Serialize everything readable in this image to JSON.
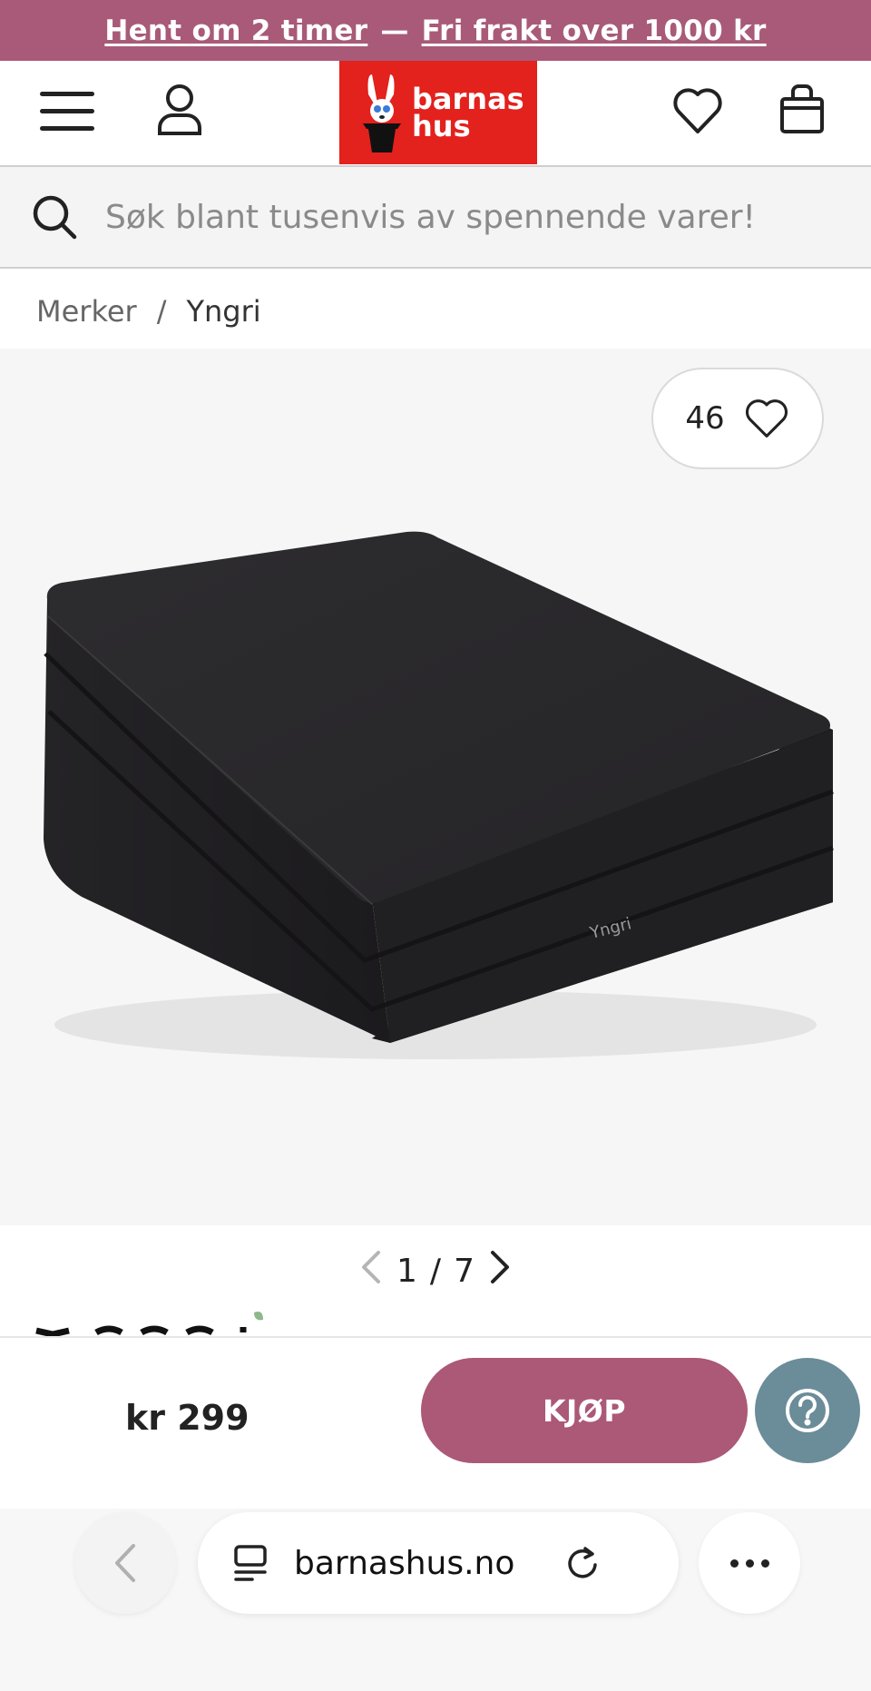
{
  "promo": {
    "pickup_text": "Hent om 2 timer",
    "separator": "—",
    "shipping_text": "Fri frakt over 1000 kr"
  },
  "header": {
    "logo_line1": "barnas",
    "logo_line2": "hus",
    "icons": [
      "menu-icon",
      "user-icon",
      "heart-icon",
      "shopping-bag-icon"
    ],
    "brand_color": "#e3211d"
  },
  "search": {
    "placeholder": "Søk blant tusenvis av spennende varer!"
  },
  "breadcrumb": {
    "items": [
      "Merker",
      "Yngri"
    ],
    "separator": "/"
  },
  "product": {
    "like_count": "46",
    "image_label": "Yngri",
    "pager_current": "1",
    "pager_separator": "/",
    "pager_total": "7"
  },
  "buy_bar": {
    "price": "kr 299",
    "buy_label": "KJØP",
    "accent_color": "#ac5877"
  },
  "browser": {
    "url": "barnashus.no"
  }
}
